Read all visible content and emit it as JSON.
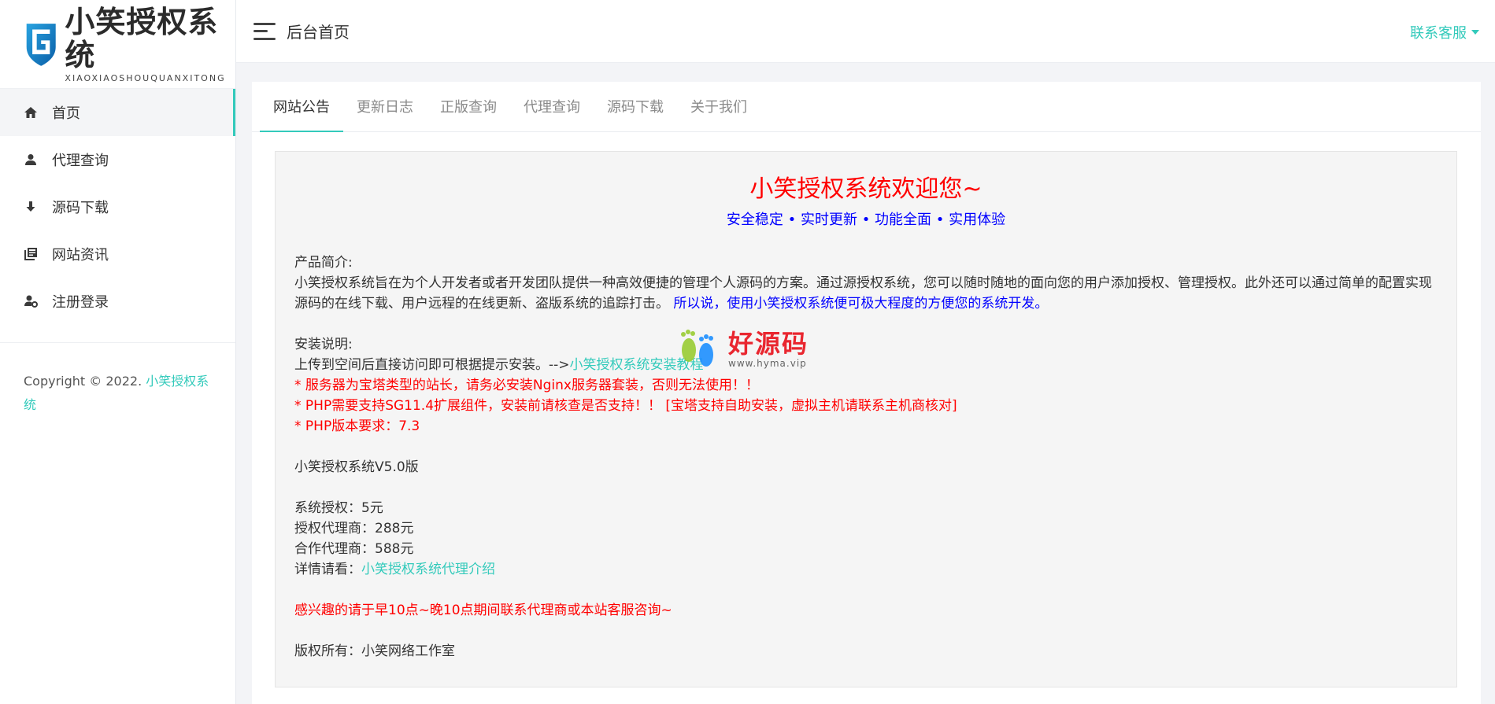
{
  "logo": {
    "cn": "小笑授权系统",
    "en": "XIAOXIAOSHOUQUANXITONG",
    "icon": "shield-g-icon"
  },
  "sidebar": {
    "items": [
      {
        "label": "首页",
        "icon": "home-icon",
        "active": true
      },
      {
        "label": "代理查询",
        "icon": "user-icon",
        "active": false
      },
      {
        "label": "源码下载",
        "icon": "download-icon",
        "active": false
      },
      {
        "label": "网站资讯",
        "icon": "news-icon",
        "active": false
      },
      {
        "label": "注册登录",
        "icon": "user-settings-icon",
        "active": false
      }
    ],
    "copyright_prefix": "Copyright © 2022.",
    "copyright_link": "小笑授权系统"
  },
  "header": {
    "title": "后台首页",
    "contact": "联系客服"
  },
  "tabs": [
    {
      "label": "网站公告",
      "active": true
    },
    {
      "label": "更新日志",
      "active": false
    },
    {
      "label": "正版查询",
      "active": false
    },
    {
      "label": "代理查询",
      "active": false
    },
    {
      "label": "源码下载",
      "active": false
    },
    {
      "label": "关于我们",
      "active": false
    }
  ],
  "notice": {
    "title": "小笑授权系统欢迎您~",
    "subtitle": "安全稳定 • 实时更新 • 功能全面 • 实用体验",
    "intro_heading": "产品简介:",
    "intro_text": "小笑授权系统旨在为个人开发者或者开发团队提供一种高效便捷的管理个人源码的方案。通过源授权系统，您可以随时随地的面向您的用户添加授权、管理授权。此外还可以通过简单的配置实现源码的在线下载、用户远程的在线更新、盗版系统的追踪打击。",
    "intro_highlight": "所以说，使用小笑授权系统便可极大程度的方便您的系统开发。",
    "install_heading": "安装说明:",
    "install_text": "上传到空间后直接访问即可根据提示安装。-->",
    "install_link": "小笑授权系统安装教程",
    "warn1": "* 服务器为宝塔类型的站长，请务必安装Nginx服务器套装，否则无法使用！！",
    "warn2": "* PHP需要支持SG11.4扩展组件，安装前请核查是否支持！！ [宝塔支持自助安装，虚拟主机请联系主机商核对]",
    "warn3": "* PHP版本要求：7.3",
    "version": "小笑授权系统V5.0版",
    "price1": "系统授权：5元",
    "price2": "授权代理商：288元",
    "price3": "合作代理商：588元",
    "details_label": "详情请看：",
    "details_link": "小笑授权系统代理介绍",
    "contact_note": "感兴趣的请于早10点~晚10点期间联系代理商或本站客服咨询~",
    "owner": "版权所有：小笑网络工作室"
  },
  "watermark": {
    "cn": "好源码",
    "url": "www.hyma.vip"
  },
  "colors": {
    "accent": "#33cabb",
    "red": "#ff0000",
    "blue": "#0000ff"
  }
}
